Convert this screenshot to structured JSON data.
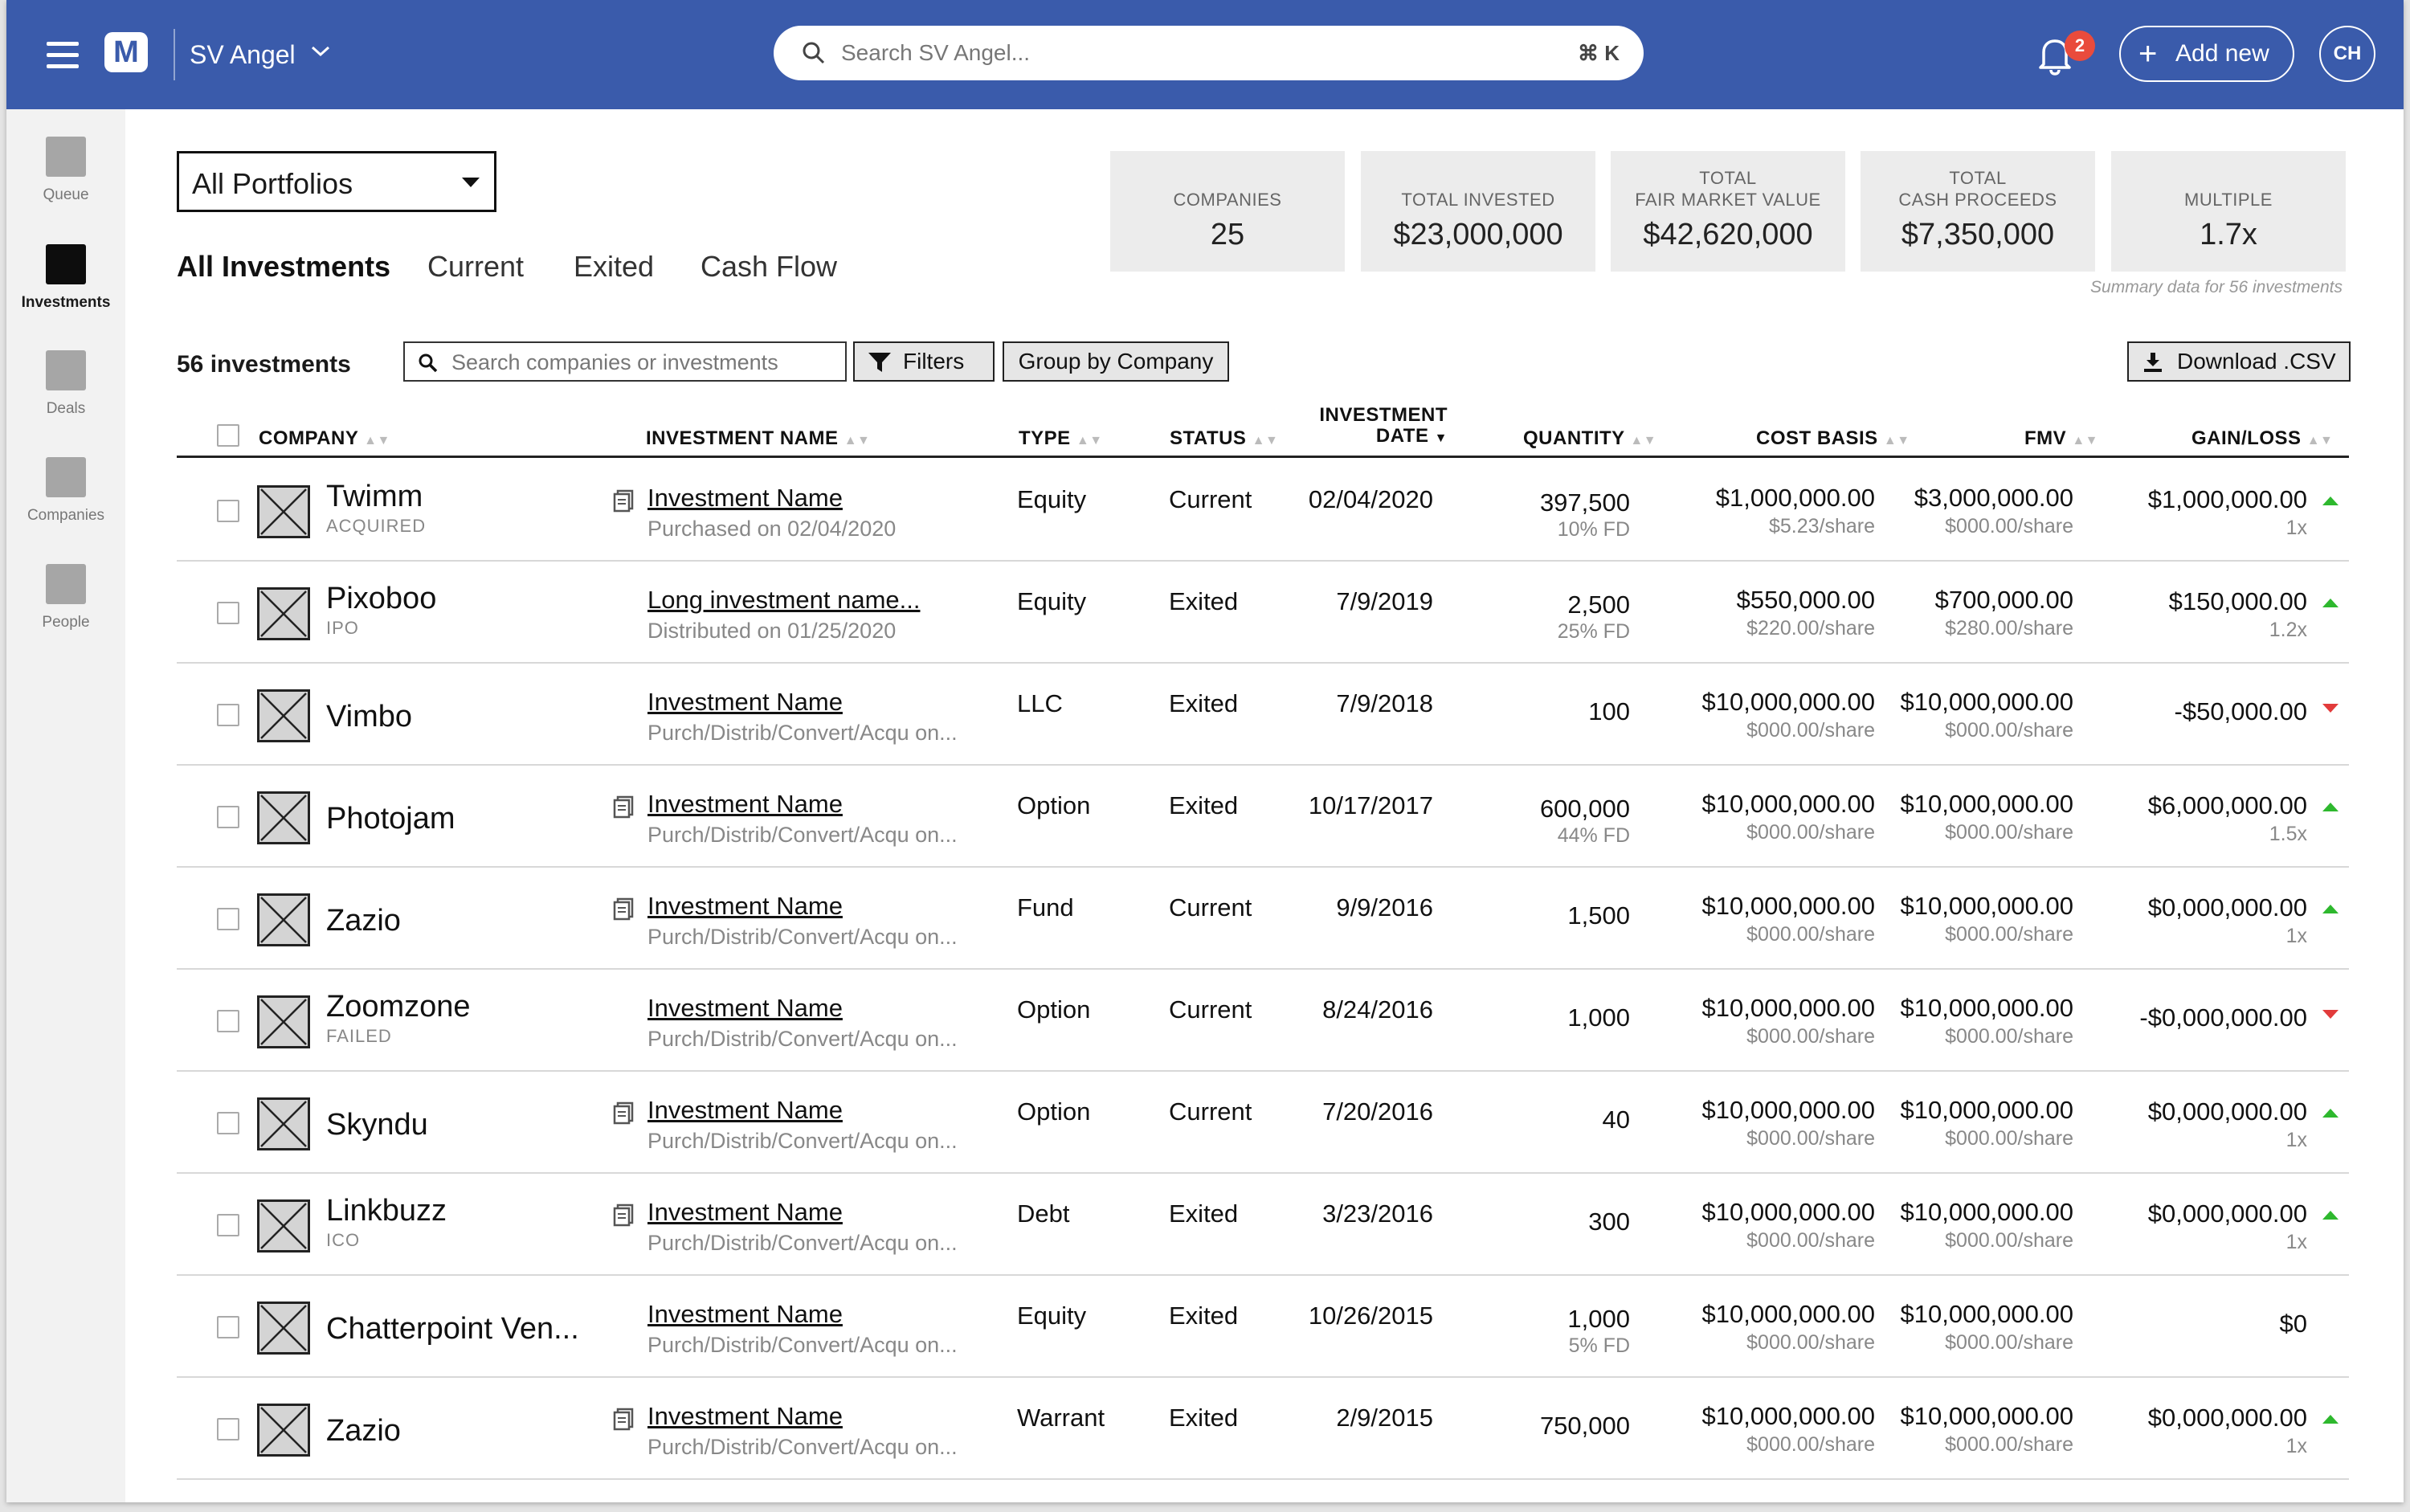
{
  "topbar": {
    "logo_letter": "M",
    "org_name": "SV Angel",
    "search_placeholder": "Search SV Angel...",
    "search_shortcut": "⌘ K",
    "notification_count": "2",
    "add_new_label": "Add new",
    "user_initials": "CH"
  },
  "sidebar": {
    "items": [
      {
        "label": "Queue",
        "active": false
      },
      {
        "label": "Investments",
        "active": true
      },
      {
        "label": "Deals",
        "active": false
      },
      {
        "label": "Companies",
        "active": false
      },
      {
        "label": "People",
        "active": false
      }
    ]
  },
  "portfolio_select": {
    "value": "All Portfolios"
  },
  "tabs": [
    {
      "label": "All Investments",
      "active": true
    },
    {
      "label": "Current",
      "active": false
    },
    {
      "label": "Exited",
      "active": false
    },
    {
      "label": "Cash Flow",
      "active": false
    }
  ],
  "stats": [
    {
      "label": "COMPANIES",
      "value": "25"
    },
    {
      "label": "TOTAL INVESTED",
      "value": "$23,000,000"
    },
    {
      "label": "TOTAL\nFAIR MARKET VALUE",
      "value": "$42,620,000"
    },
    {
      "label": "TOTAL\nCASH PROCEEDS",
      "value": "$7,350,000"
    },
    {
      "label": "MULTIPLE",
      "value": "1.7x"
    }
  ],
  "summary_note": "Summary data for 56 investments",
  "toolbar": {
    "count": "56 investments",
    "search_placeholder": "Search companies or investments",
    "filters_label": "Filters",
    "group_label": "Group  by Company",
    "download_label": "Download .CSV"
  },
  "table": {
    "headers": {
      "company": "COMPANY",
      "investment_name": "INVESTMENT NAME",
      "type": "TYPE",
      "status": "STATUS",
      "date_line1": "INVESTMENT",
      "date_line2": "DATE",
      "quantity": "QUANTITY",
      "cost_basis": "COST BASIS",
      "fmv": "FMV",
      "gain_loss": "GAIN/LOSS"
    },
    "rows": [
      {
        "company": "Twimm",
        "company_sub": "ACQUIRED",
        "doc_icon": true,
        "inv_name": "Investment Name",
        "inv_sub": "Purchased on 02/04/2020",
        "type": "Equity",
        "status": "Current",
        "date": "02/04/2020",
        "qty": "397,500",
        "qty_sub": "10% FD",
        "cost": "$1,000,000.00",
        "cost_sub": "$5.23/share",
        "fmv": "$3,000,000.00",
        "fmv_sub": "$000.00/share",
        "gain": "$1,000,000.00",
        "gain_sub": "1x",
        "trend": "up"
      },
      {
        "company": "Pixoboo",
        "company_sub": "IPO",
        "doc_icon": false,
        "inv_name": "Long investment name...",
        "inv_sub": "Distributed on 01/25/2020",
        "type": "Equity",
        "status": "Exited",
        "date": "7/9/2019",
        "qty": "2,500",
        "qty_sub": "25% FD",
        "cost": "$550,000.00",
        "cost_sub": "$220.00/share",
        "fmv": "$700,000.00",
        "fmv_sub": "$280.00/share",
        "gain": "$150,000.00",
        "gain_sub": "1.2x",
        "trend": "up"
      },
      {
        "company": "Vimbo",
        "company_sub": "",
        "doc_icon": false,
        "inv_name": "Investment Name",
        "inv_sub": "Purch/Distrib/Convert/Acqu on...",
        "type": "LLC",
        "status": "Exited",
        "date": "7/9/2018",
        "qty": "100",
        "qty_sub": "",
        "cost": "$10,000,000.00",
        "cost_sub": "$000.00/share",
        "fmv": "$10,000,000.00",
        "fmv_sub": "$000.00/share",
        "gain": "-$50,000.00",
        "gain_sub": "",
        "trend": "down"
      },
      {
        "company": "Photojam",
        "company_sub": "",
        "doc_icon": true,
        "inv_name": "Investment Name",
        "inv_sub": "Purch/Distrib/Convert/Acqu on...",
        "type": "Option",
        "status": "Exited",
        "date": "10/17/2017",
        "qty": "600,000",
        "qty_sub": "44% FD",
        "cost": "$10,000,000.00",
        "cost_sub": "$000.00/share",
        "fmv": "$10,000,000.00",
        "fmv_sub": "$000.00/share",
        "gain": "$6,000,000.00",
        "gain_sub": "1.5x",
        "trend": "up"
      },
      {
        "company": "Zazio",
        "company_sub": "",
        "doc_icon": true,
        "inv_name": "Investment Name",
        "inv_sub": "Purch/Distrib/Convert/Acqu on...",
        "type": "Fund",
        "status": "Current",
        "date": "9/9/2016",
        "qty": "1,500",
        "qty_sub": "",
        "cost": "$10,000,000.00",
        "cost_sub": "$000.00/share",
        "fmv": "$10,000,000.00",
        "fmv_sub": "$000.00/share",
        "gain": "$0,000,000.00",
        "gain_sub": "1x",
        "trend": "up"
      },
      {
        "company": "Zoomzone",
        "company_sub": "FAILED",
        "doc_icon": false,
        "inv_name": "Investment Name",
        "inv_sub": "Purch/Distrib/Convert/Acqu on...",
        "type": "Option",
        "status": "Current",
        "date": "8/24/2016",
        "qty": "1,000",
        "qty_sub": "",
        "cost": "$10,000,000.00",
        "cost_sub": "$000.00/share",
        "fmv": "$10,000,000.00",
        "fmv_sub": "$000.00/share",
        "gain": "-$0,000,000.00",
        "gain_sub": "",
        "trend": "down"
      },
      {
        "company": "Skyndu",
        "company_sub": "",
        "doc_icon": true,
        "inv_name": "Investment Name",
        "inv_sub": "Purch/Distrib/Convert/Acqu on...",
        "type": "Option",
        "status": "Current",
        "date": "7/20/2016",
        "qty": "40",
        "qty_sub": "",
        "cost": "$10,000,000.00",
        "cost_sub": "$000.00/share",
        "fmv": "$10,000,000.00",
        "fmv_sub": "$000.00/share",
        "gain": "$0,000,000.00",
        "gain_sub": "1x",
        "trend": "up"
      },
      {
        "company": "Linkbuzz",
        "company_sub": "ICO",
        "doc_icon": true,
        "inv_name": "Investment Name",
        "inv_sub": "Purch/Distrib/Convert/Acqu on...",
        "type": "Debt",
        "status": "Exited",
        "date": "3/23/2016",
        "qty": "300",
        "qty_sub": "",
        "cost": "$10,000,000.00",
        "cost_sub": "$000.00/share",
        "fmv": "$10,000,000.00",
        "fmv_sub": "$000.00/share",
        "gain": "$0,000,000.00",
        "gain_sub": "1x",
        "trend": "up"
      },
      {
        "company": "Chatterpoint Ven...",
        "company_sub": "",
        "doc_icon": false,
        "inv_name": "Investment Name",
        "inv_sub": "Purch/Distrib/Convert/Acqu on...",
        "type": "Equity",
        "status": "Exited",
        "date": "10/26/2015",
        "qty": "1,000",
        "qty_sub": "5% FD",
        "cost": "$10,000,000.00",
        "cost_sub": "$000.00/share",
        "fmv": "$10,000,000.00",
        "fmv_sub": "$000.00/share",
        "gain": "$0",
        "gain_sub": "",
        "trend": "none"
      },
      {
        "company": "Zazio",
        "company_sub": "",
        "doc_icon": true,
        "inv_name": "Investment Name",
        "inv_sub": "Purch/Distrib/Convert/Acqu on...",
        "type": "Warrant",
        "status": "Exited",
        "date": "2/9/2015",
        "qty": "750,000",
        "qty_sub": "",
        "cost": "$10,000,000.00",
        "cost_sub": "$000.00/share",
        "fmv": "$10,000,000.00",
        "fmv_sub": "$000.00/share",
        "gain": "$0,000,000.00",
        "gain_sub": "1x",
        "trend": "up"
      }
    ]
  },
  "colors": {
    "topbar": "#3a5bab",
    "badge": "#e94b3c",
    "gain_up": "#2eb82e",
    "gain_down": "#e23b3b"
  }
}
